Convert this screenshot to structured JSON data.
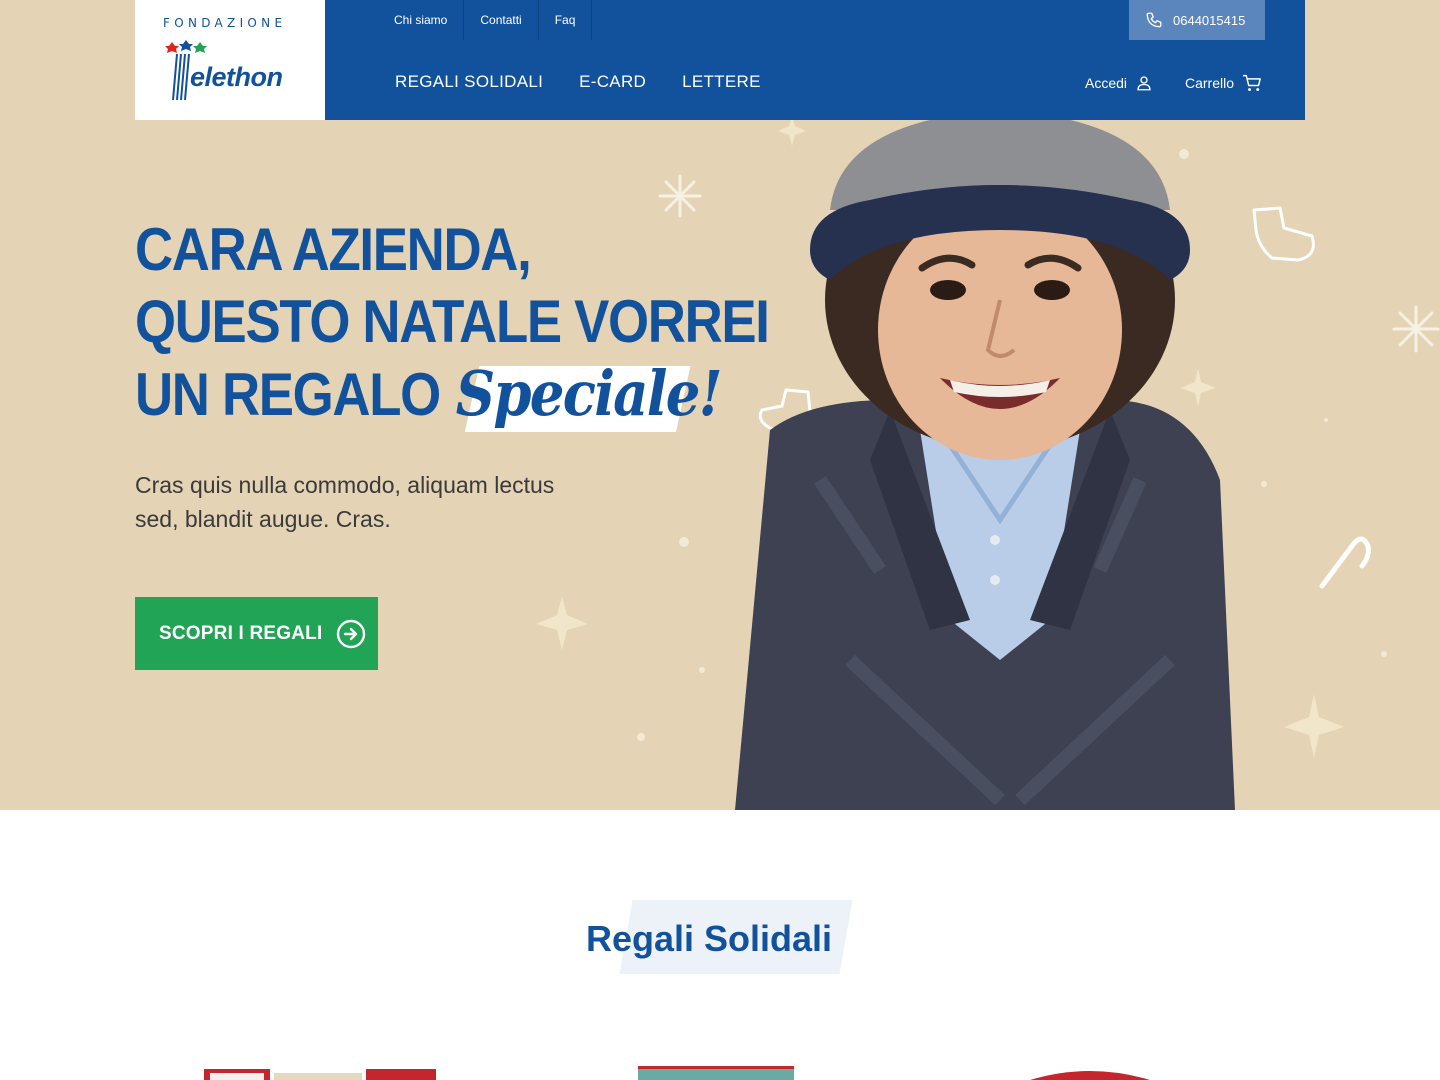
{
  "header": {
    "logo_top": "FONDAZIONE",
    "logo_word": "Telethon",
    "top_links": [
      "Chi siamo",
      "Contatti",
      "Faq"
    ],
    "phone": "0644015415",
    "main_nav": [
      "REGALI SOLIDALI",
      "E-CARD",
      "LETTERE"
    ],
    "login_label": "Accedi",
    "cart_label": "Carrello"
  },
  "hero": {
    "line1": "CARA AZIENDA,",
    "line2": "QUESTO NATALE VORREI",
    "line3": "UN REGALO",
    "highlight": "Speciale!",
    "subtext": "Cras quis nulla commodo, aliquam lectus sed, blandit augue. Cras.",
    "cta_label": "SCOPRI I REGALI"
  },
  "section": {
    "title": "Regali Solidali"
  },
  "colors": {
    "brand_blue": "#12519b",
    "hero_beige": "#e4d3b5",
    "cta_green": "#21a455",
    "phone_box": "#5b86bd"
  },
  "icons": [
    "phone-icon",
    "user-icon",
    "cart-icon",
    "arrow-circle-right-icon",
    "snowflake-icon",
    "stocking-icon",
    "candy-cane-icon",
    "star-icon"
  ]
}
